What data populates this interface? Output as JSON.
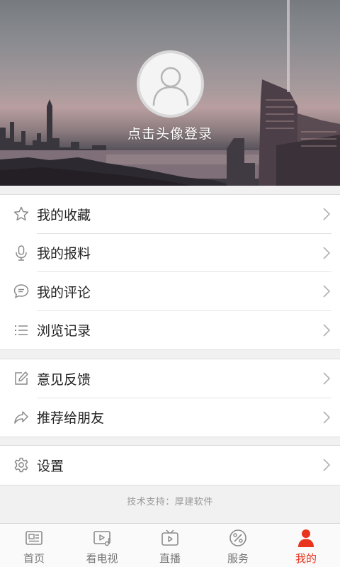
{
  "header": {
    "login_text": "点击头像登录"
  },
  "menu_group_1": [
    {
      "label": "我的收藏",
      "icon": "star-icon"
    },
    {
      "label": "我的报料",
      "icon": "microphone-icon"
    },
    {
      "label": "我的评论",
      "icon": "comment-icon"
    },
    {
      "label": "浏览记录",
      "icon": "list-icon"
    }
  ],
  "menu_group_2": [
    {
      "label": "意见反馈",
      "icon": "edit-icon"
    },
    {
      "label": "推荐给朋友",
      "icon": "share-icon"
    }
  ],
  "menu_group_3": [
    {
      "label": "设置",
      "icon": "gear-icon"
    }
  ],
  "support_text": "技术支持：厚建软件",
  "tabbar": {
    "tabs": [
      {
        "label": "首页",
        "icon": "news-icon",
        "active": false
      },
      {
        "label": "看电视",
        "icon": "tv-music-icon",
        "active": false
      },
      {
        "label": "直播",
        "icon": "live-tv-icon",
        "active": false
      },
      {
        "label": "服务",
        "icon": "service-icon",
        "active": false
      },
      {
        "label": "我的",
        "icon": "person-icon",
        "active": true
      }
    ],
    "active_color": "#e8331e",
    "inactive_color": "#777777"
  }
}
